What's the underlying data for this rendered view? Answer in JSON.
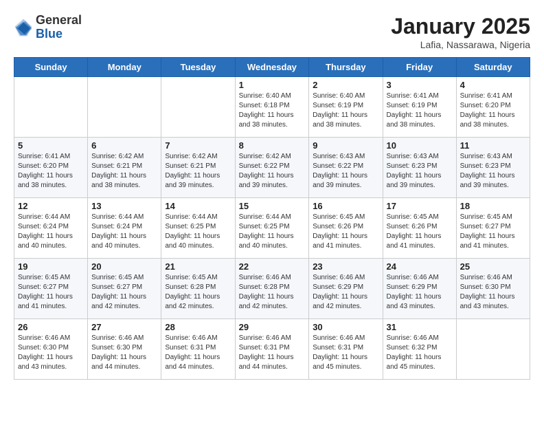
{
  "header": {
    "logo": {
      "general": "General",
      "blue": "Blue"
    },
    "title": "January 2025",
    "subtitle": "Lafia, Nassarawa, Nigeria"
  },
  "weekdays": [
    "Sunday",
    "Monday",
    "Tuesday",
    "Wednesday",
    "Thursday",
    "Friday",
    "Saturday"
  ],
  "weeks": [
    [
      {
        "day": null
      },
      {
        "day": null
      },
      {
        "day": null
      },
      {
        "day": 1,
        "sunrise": "6:40 AM",
        "sunset": "6:18 PM",
        "daylight": "11 hours and 38 minutes."
      },
      {
        "day": 2,
        "sunrise": "6:40 AM",
        "sunset": "6:19 PM",
        "daylight": "11 hours and 38 minutes."
      },
      {
        "day": 3,
        "sunrise": "6:41 AM",
        "sunset": "6:19 PM",
        "daylight": "11 hours and 38 minutes."
      },
      {
        "day": 4,
        "sunrise": "6:41 AM",
        "sunset": "6:20 PM",
        "daylight": "11 hours and 38 minutes."
      }
    ],
    [
      {
        "day": 5,
        "sunrise": "6:41 AM",
        "sunset": "6:20 PM",
        "daylight": "11 hours and 38 minutes."
      },
      {
        "day": 6,
        "sunrise": "6:42 AM",
        "sunset": "6:21 PM",
        "daylight": "11 hours and 38 minutes."
      },
      {
        "day": 7,
        "sunrise": "6:42 AM",
        "sunset": "6:21 PM",
        "daylight": "11 hours and 39 minutes."
      },
      {
        "day": 8,
        "sunrise": "6:42 AM",
        "sunset": "6:22 PM",
        "daylight": "11 hours and 39 minutes."
      },
      {
        "day": 9,
        "sunrise": "6:43 AM",
        "sunset": "6:22 PM",
        "daylight": "11 hours and 39 minutes."
      },
      {
        "day": 10,
        "sunrise": "6:43 AM",
        "sunset": "6:23 PM",
        "daylight": "11 hours and 39 minutes."
      },
      {
        "day": 11,
        "sunrise": "6:43 AM",
        "sunset": "6:23 PM",
        "daylight": "11 hours and 39 minutes."
      }
    ],
    [
      {
        "day": 12,
        "sunrise": "6:44 AM",
        "sunset": "6:24 PM",
        "daylight": "11 hours and 40 minutes."
      },
      {
        "day": 13,
        "sunrise": "6:44 AM",
        "sunset": "6:24 PM",
        "daylight": "11 hours and 40 minutes."
      },
      {
        "day": 14,
        "sunrise": "6:44 AM",
        "sunset": "6:25 PM",
        "daylight": "11 hours and 40 minutes."
      },
      {
        "day": 15,
        "sunrise": "6:44 AM",
        "sunset": "6:25 PM",
        "daylight": "11 hours and 40 minutes."
      },
      {
        "day": 16,
        "sunrise": "6:45 AM",
        "sunset": "6:26 PM",
        "daylight": "11 hours and 41 minutes."
      },
      {
        "day": 17,
        "sunrise": "6:45 AM",
        "sunset": "6:26 PM",
        "daylight": "11 hours and 41 minutes."
      },
      {
        "day": 18,
        "sunrise": "6:45 AM",
        "sunset": "6:27 PM",
        "daylight": "11 hours and 41 minutes."
      }
    ],
    [
      {
        "day": 19,
        "sunrise": "6:45 AM",
        "sunset": "6:27 PM",
        "daylight": "11 hours and 41 minutes."
      },
      {
        "day": 20,
        "sunrise": "6:45 AM",
        "sunset": "6:27 PM",
        "daylight": "11 hours and 42 minutes."
      },
      {
        "day": 21,
        "sunrise": "6:45 AM",
        "sunset": "6:28 PM",
        "daylight": "11 hours and 42 minutes."
      },
      {
        "day": 22,
        "sunrise": "6:46 AM",
        "sunset": "6:28 PM",
        "daylight": "11 hours and 42 minutes."
      },
      {
        "day": 23,
        "sunrise": "6:46 AM",
        "sunset": "6:29 PM",
        "daylight": "11 hours and 42 minutes."
      },
      {
        "day": 24,
        "sunrise": "6:46 AM",
        "sunset": "6:29 PM",
        "daylight": "11 hours and 43 minutes."
      },
      {
        "day": 25,
        "sunrise": "6:46 AM",
        "sunset": "6:30 PM",
        "daylight": "11 hours and 43 minutes."
      }
    ],
    [
      {
        "day": 26,
        "sunrise": "6:46 AM",
        "sunset": "6:30 PM",
        "daylight": "11 hours and 43 minutes."
      },
      {
        "day": 27,
        "sunrise": "6:46 AM",
        "sunset": "6:30 PM",
        "daylight": "11 hours and 44 minutes."
      },
      {
        "day": 28,
        "sunrise": "6:46 AM",
        "sunset": "6:31 PM",
        "daylight": "11 hours and 44 minutes."
      },
      {
        "day": 29,
        "sunrise": "6:46 AM",
        "sunset": "6:31 PM",
        "daylight": "11 hours and 44 minutes."
      },
      {
        "day": 30,
        "sunrise": "6:46 AM",
        "sunset": "6:31 PM",
        "daylight": "11 hours and 45 minutes."
      },
      {
        "day": 31,
        "sunrise": "6:46 AM",
        "sunset": "6:32 PM",
        "daylight": "11 hours and 45 minutes."
      },
      {
        "day": null
      }
    ]
  ],
  "labels": {
    "sunrise_prefix": "Sunrise: ",
    "sunset_prefix": "Sunset: ",
    "daylight_label": "Daylight: "
  }
}
